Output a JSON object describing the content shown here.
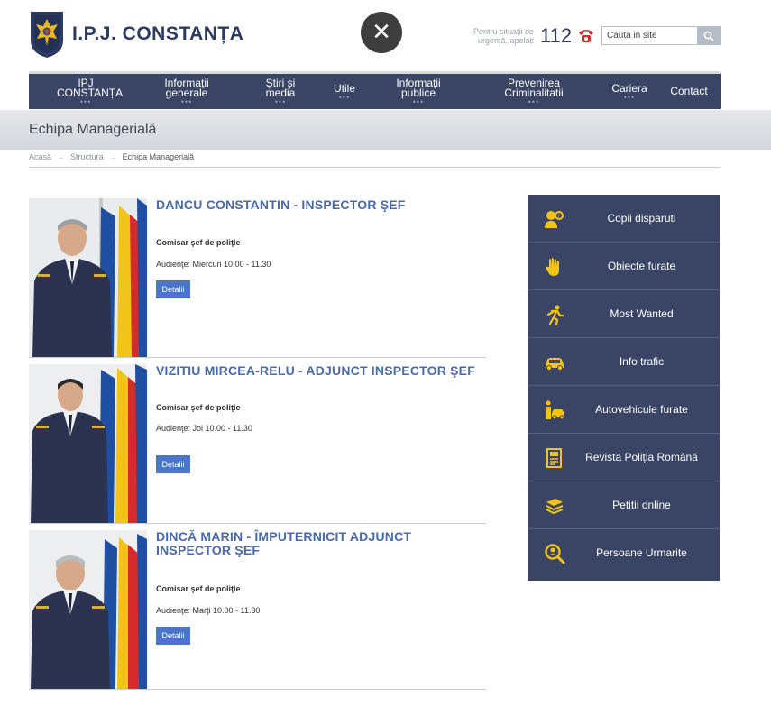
{
  "header": {
    "title": "I.P.J. CONSTANȚA",
    "close_symbol": "✕",
    "emergency_text": "Pentru situații de urgență, apelați",
    "emergency_number": "112",
    "search_placeholder": "Cauta in site"
  },
  "nav": {
    "items": [
      {
        "label": "IPJ CONSTANȚA",
        "has_submenu": true
      },
      {
        "label": "Informații generale",
        "has_submenu": true
      },
      {
        "label": "Știri și media",
        "has_submenu": true
      },
      {
        "label": "Utile",
        "has_submenu": true
      },
      {
        "label": "Informații publice",
        "has_submenu": true
      },
      {
        "label": "Prevenirea Criminalitatii",
        "has_submenu": true
      },
      {
        "label": "Cariera",
        "has_submenu": true
      },
      {
        "label": "Contact",
        "has_submenu": false
      }
    ],
    "submenu_dots": "•••"
  },
  "page": {
    "title": "Echipa Managerială",
    "breadcrumb": [
      "Acasă",
      "Structura",
      "Echipa Managerială"
    ],
    "breadcrumb_sep": "→"
  },
  "people": [
    {
      "name": "DANCU CONSTANTIN - INSPECTOR ŞEF",
      "rank": "Comisar şef de poliţie",
      "audiente": "Audienţe: Miercuri 10.00 - 11.30",
      "button": "Detalii"
    },
    {
      "name": "VIZITIU MIRCEA-RELU - ADJUNCT INSPECTOR ŞEF",
      "rank": "Comisar şef de poliţie",
      "audiente": "Audienţe: Joi 10.00 - 11.30",
      "button": "Detalii"
    },
    {
      "name": "DINCĂ MARIN - ÎMPUTERNICIT ADJUNCT INSPECTOR ŞEF",
      "rank": "Comisar şef de poliţie",
      "audiente": "Audienţe: Marţi 10.00 - 11.30",
      "button": "Detalii"
    }
  ],
  "sidebar": {
    "items": [
      {
        "label": "Copii disparuti",
        "icon": "missing-child-icon"
      },
      {
        "label": "Obiecte furate",
        "icon": "hand-icon"
      },
      {
        "label": "Most Wanted",
        "icon": "running-person-icon"
      },
      {
        "label": "Info trafic",
        "icon": "car-icon"
      },
      {
        "label": "Autovehicule furate",
        "icon": "stolen-car-icon"
      },
      {
        "label": "Revista Poliția Română",
        "icon": "magazine-icon"
      },
      {
        "label": "Petitii online",
        "icon": "documents-stack-icon"
      },
      {
        "label": "Persoane Urmarite",
        "icon": "search-person-icon"
      }
    ]
  },
  "colors": {
    "navy": "#3a4566",
    "accent_yellow": "#f2c318",
    "name_blue": "#4a6aa8",
    "button_blue": "#4a75c8"
  }
}
